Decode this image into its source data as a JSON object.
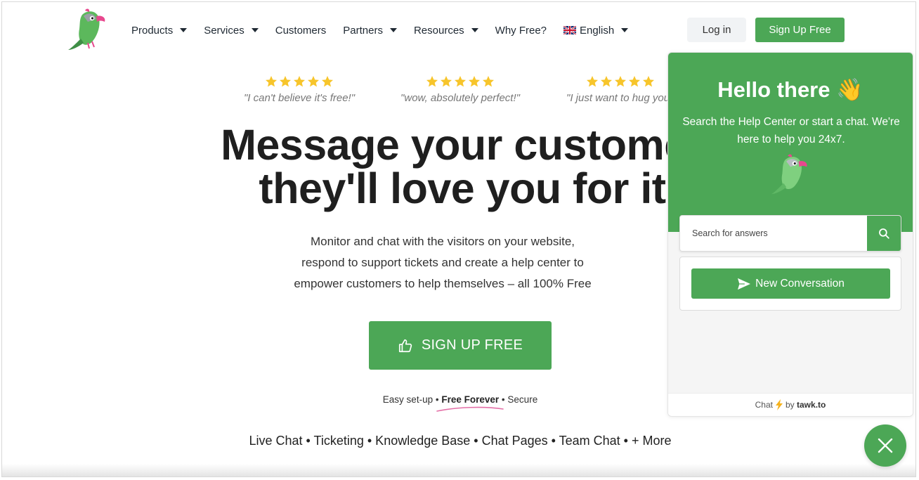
{
  "colors": {
    "brand_green": "#4ca756",
    "star_yellow": "#f7c52b",
    "text_dark": "#1f1f1f",
    "swoosh_pink": "#e46fa7"
  },
  "header": {
    "logo_icon": "parrot-logo-icon",
    "nav": [
      {
        "label": "Products",
        "has_dropdown": true
      },
      {
        "label": "Services",
        "has_dropdown": true
      },
      {
        "label": "Customers",
        "has_dropdown": false
      },
      {
        "label": "Partners",
        "has_dropdown": true
      },
      {
        "label": "Resources",
        "has_dropdown": true
      },
      {
        "label": "Why Free?",
        "has_dropdown": false
      }
    ],
    "language": {
      "label": "English",
      "flag_icon": "uk-flag-icon"
    },
    "login_label": "Log in",
    "signup_label": "Sign Up Free"
  },
  "testimonials": [
    {
      "rating": 5,
      "quote": "\"I can't believe it's free!\""
    },
    {
      "rating": 5,
      "quote": "\"wow, absolutely perfect!\""
    },
    {
      "rating": 5,
      "quote": "\"I just want to hug you"
    }
  ],
  "hero": {
    "headline_line1": "Message your customer",
    "headline_line2": "they'll love you for it",
    "sub_line1": "Monitor and chat with the visitors on your website,",
    "sub_line2": "respond to support tickets and create a help center to",
    "sub_line3": "empower customers to help themselves – all 100% Free",
    "cta_icon": "thumbs-up-icon",
    "cta_label": "SIGN UP FREE",
    "features": {
      "part1": "Easy set-up",
      "part2": "Free Forever",
      "part3": "Secure",
      "separator": "•"
    },
    "products_line": "Live Chat • Ticketing • Knowledge Base • Chat Pages • Team Chat • + More"
  },
  "chat_widget": {
    "title": "Hello there 👋",
    "subtitle": "Search the Help Center or start a chat. We're here to help you 24x7.",
    "search_placeholder": "Search for answers",
    "search_icon": "search-icon",
    "new_conversation_label": "New Conversation",
    "new_conversation_icon": "send-icon",
    "footer": {
      "prefix": "Chat",
      "by": "by",
      "brand": "tawk.to",
      "icon": "lightning-icon"
    },
    "close_icon": "close-icon"
  }
}
